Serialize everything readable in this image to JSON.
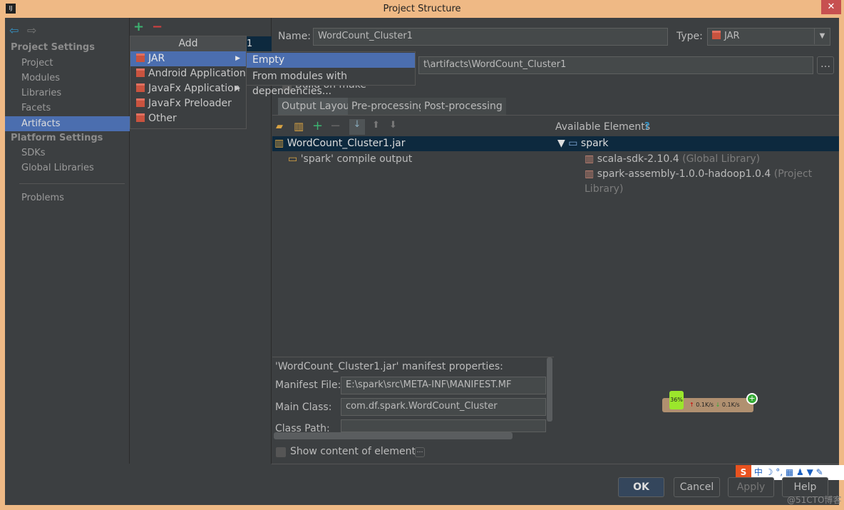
{
  "window": {
    "title": "Project Structure",
    "close": "✕",
    "app_icon": "IJ"
  },
  "sidebar": {
    "project_settings": "Project Settings",
    "project_items": [
      "Project",
      "Modules",
      "Libraries",
      "Facets",
      "Artifacts"
    ],
    "platform_settings": "Platform Settings",
    "platform_items": [
      "SDKs",
      "Global Libraries"
    ],
    "problems": "Problems",
    "selected": "Artifacts"
  },
  "mid": {
    "add_icon": "+",
    "remove_icon": "−",
    "selected_suffix": "1"
  },
  "add_menu": {
    "title": "Add",
    "items": [
      "JAR",
      "Android Application",
      "JavaFx Application",
      "JavaFx Preloader",
      "Other"
    ],
    "selected": "JAR"
  },
  "jar_submenu": {
    "items": [
      "Empty",
      "From modules with dependencies..."
    ],
    "selected": "Empty"
  },
  "artifact": {
    "name_label": "Name:",
    "name_value": "WordCount_Cluster1",
    "type_label": "Type:",
    "type_value": "JAR",
    "output_dir_visible": "t\\artifacts\\WordCount_Cluster1",
    "build_on_make": "Build on make",
    "tabs": [
      "Output Layout",
      "Pre-processing",
      "Post-processing"
    ],
    "active_tab": "Output Layout"
  },
  "layout_tree": {
    "root": "WordCount_Cluster1.jar",
    "children": [
      "'spark' compile output"
    ]
  },
  "available": {
    "title": "Available Elements",
    "help": "?",
    "module": "spark",
    "libs": [
      {
        "name": "scala-sdk-2.10.4",
        "kind": "(Global Library)"
      },
      {
        "name": "spark-assembly-1.0.0-hadoop1.0.4",
        "kind": "(Project Library)"
      }
    ]
  },
  "manifest": {
    "title": "'WordCount_Cluster1.jar' manifest properties:",
    "file_label": "Manifest File:",
    "file_value": "E:\\spark\\src\\META-INF\\MANIFEST.MF",
    "main_label": "Main Class:",
    "main_value": "com.df.spark.WordCount_Cluster",
    "classpath_label": "Class Path:"
  },
  "show_content": "Show content of elements",
  "buttons": {
    "ok": "OK",
    "cancel": "Cancel",
    "apply": "Apply",
    "help": "Help"
  },
  "net_widget": {
    "percent": "36%",
    "up": "0.1K/s",
    "down": "0.1K/s"
  },
  "ime": {
    "lang": "中"
  },
  "watermark": "@51CTO博客"
}
